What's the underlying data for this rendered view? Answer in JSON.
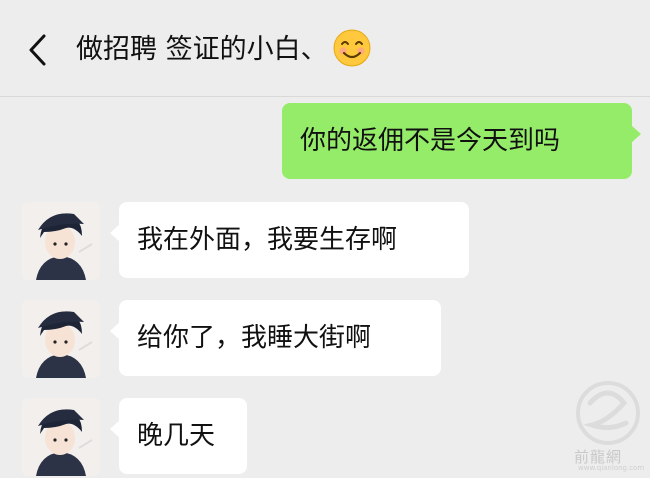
{
  "header": {
    "title": "做招聘 签证的小白、",
    "emoji": "smiling-face-emoji"
  },
  "messages": [
    {
      "sender": "me",
      "text": "你的返佣不是今天到吗"
    },
    {
      "sender": "other",
      "text": "我在外面，我要生存啊"
    },
    {
      "sender": "other",
      "text": "给你了，我睡大街啊"
    },
    {
      "sender": "other",
      "text": "晚几天"
    }
  ],
  "colors": {
    "background": "#ededed",
    "my_bubble": "#95ec69",
    "other_bubble": "#ffffff"
  },
  "watermark": {
    "text": "前龍網",
    "sub": "www.qianlong.com"
  }
}
